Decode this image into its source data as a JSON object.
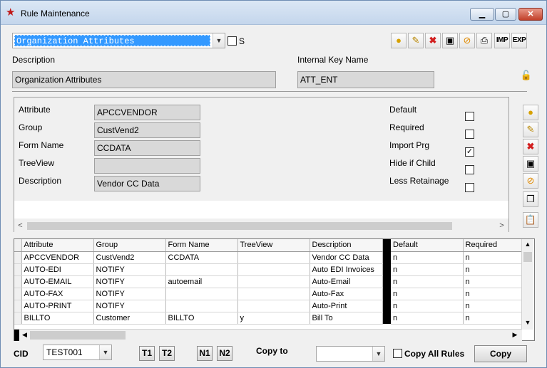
{
  "window": {
    "title": "Rule Maintenance"
  },
  "top": {
    "rule_select": "Organization Attributes",
    "s_label": "S",
    "description_label": "Description",
    "description_value": "Organization Attributes",
    "internal_key_label": "Internal Key Name",
    "internal_key_value": "ATT_ENT",
    "imp_label": "IMP",
    "exp_label": "EXP"
  },
  "detail": {
    "attribute_label": "Attribute",
    "attribute_value": "APCCVENDOR",
    "group_label": "Group",
    "group_value": "CustVend2",
    "form_label": "Form Name",
    "form_value": "CCDATA",
    "treeview_label": "TreeView",
    "treeview_value": "",
    "desc_label": "Description",
    "desc_value": "Vendor CC Data",
    "default_label": "Default",
    "required_label": "Required",
    "import_label": "Import Prg",
    "hide_label": "Hide if Child",
    "less_label": "Less Retainage",
    "flags": {
      "default": false,
      "required": false,
      "import_prg": true,
      "hide_if_child": false,
      "less_retainage": false
    }
  },
  "grid": {
    "columns": [
      "Attribute",
      "Group",
      "Form Name",
      "TreeView",
      "Description",
      "Default",
      "Required"
    ],
    "rows": [
      [
        "APCCVENDOR",
        "CustVend2",
        "CCDATA",
        "",
        "Vendor CC Data",
        "n",
        "n"
      ],
      [
        "AUTO-EDI",
        "NOTIFY",
        "",
        "",
        "Auto EDI Invoices",
        "n",
        "n"
      ],
      [
        "AUTO-EMAIL",
        "NOTIFY",
        "autoemail",
        "",
        "Auto-Email",
        "n",
        "n"
      ],
      [
        "AUTO-FAX",
        "NOTIFY",
        "",
        "",
        "Auto-Fax",
        "n",
        "n"
      ],
      [
        "AUTO-PRINT",
        "NOTIFY",
        "",
        "",
        "Auto-Print",
        "n",
        "n"
      ],
      [
        "BILLTO",
        "Customer",
        "BILLTO",
        "y",
        "Bill To",
        "n",
        "n"
      ]
    ]
  },
  "bottom": {
    "cid_label": "CID",
    "cid_value": "TEST001",
    "t1": "T1",
    "t2": "T2",
    "n1": "N1",
    "n2": "N2",
    "copy_to_label": "Copy to",
    "copy_to_value": "",
    "copy_all_label": "Copy All Rules",
    "copy_button": "Copy"
  },
  "colors": {
    "selection": "#3399ff",
    "field_bg": "#d9d9d9",
    "window_bg": "#f0f0f0"
  }
}
